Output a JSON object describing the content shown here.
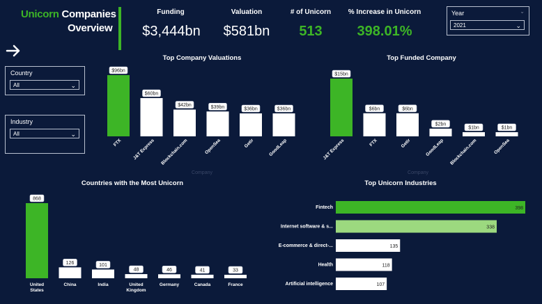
{
  "header": {
    "title_accent": "Unicorn",
    "title_rest": "Companies",
    "title_line2": "Overview"
  },
  "kpis": [
    {
      "label": "Funding",
      "value": "$3,444bn",
      "highlight": false
    },
    {
      "label": "Valuation",
      "value": "$581bn",
      "highlight": false
    },
    {
      "label": "# of Unicorn",
      "value": "513",
      "highlight": true
    },
    {
      "label": "% Increase in Unicorn",
      "value": "398.01%",
      "highlight": true
    }
  ],
  "year_slicer": {
    "label": "Year",
    "value": "2021"
  },
  "country_slicer": {
    "label": "Country",
    "value": "All"
  },
  "industry_slicer": {
    "label": "Industry",
    "value": "All"
  },
  "colors": {
    "background": "#0b1a3a",
    "accent": "#3db526",
    "accent_light": "#9cd97f",
    "bar": "#ffffff"
  },
  "chart_data": [
    {
      "id": "valuations",
      "type": "bar",
      "title": "Top Company Valuations",
      "xlabel": "Company",
      "categories": [
        "FTX",
        "J&T Express",
        "Blockchain.com",
        "OpenSea",
        "Getir",
        "GoodLeap"
      ],
      "values": [
        96,
        60,
        42,
        39,
        36,
        36
      ],
      "data_labels": [
        "$96bn",
        "$60bn",
        "$42bn",
        "$39bn",
        "$36bn",
        "$36bn"
      ],
      "highlight_index": 0
    },
    {
      "id": "funded",
      "type": "bar",
      "title": "Top Funded Company",
      "xlabel": "Company",
      "categories": [
        "J&T Express",
        "FTX",
        "Getir",
        "GoodLeap",
        "Blockchain.com",
        "OpenSea"
      ],
      "values": [
        15,
        6,
        6,
        2,
        1,
        1
      ],
      "data_labels": [
        "$15bn",
        "$6bn",
        "$6bn",
        "$2bn",
        "$1bn",
        "$1bn"
      ],
      "highlight_index": 0
    },
    {
      "id": "countries",
      "type": "bar",
      "title": "Countries with the Most Unicorn",
      "categories": [
        "United States",
        "China",
        "India",
        "United Kingdom",
        "Germany",
        "Canada",
        "France"
      ],
      "values": [
        868,
        126,
        101,
        48,
        46,
        41,
        33
      ],
      "data_labels": [
        "868",
        "126",
        "101",
        "48",
        "46",
        "41",
        "33"
      ],
      "highlight_index": 0
    },
    {
      "id": "industries",
      "type": "bar",
      "orientation": "horizontal",
      "title": "Top Unicorn Industries",
      "categories": [
        "Fintech",
        "Internet software & s...",
        "E-commerce & direct-...",
        "Health",
        "Artificial intelligence"
      ],
      "values": [
        398,
        338,
        135,
        118,
        107
      ],
      "data_labels": [
        "398",
        "338",
        "135",
        "118",
        "107"
      ],
      "highlight_index": 0,
      "second_highlight_index": 1
    }
  ]
}
